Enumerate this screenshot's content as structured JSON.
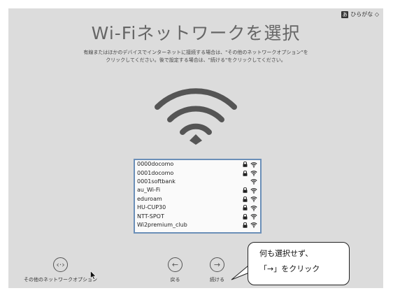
{
  "ime": {
    "badge": "あ",
    "label": "ひらがな ◇"
  },
  "title": "Wi-Fiネットワークを選択",
  "description": {
    "line1": "有線またはほかのデバイスでインターネットに接続する場合は、\"その他のネットワークオプション\"を",
    "line2": "クリックしてください。後で設定する場合は、\"続ける\"をクリックしてください。"
  },
  "networks": [
    {
      "name": "0000docomo",
      "locked": true
    },
    {
      "name": "0001docomo",
      "locked": true
    },
    {
      "name": "0001softbank",
      "locked": false
    },
    {
      "name": "au_Wi-Fi",
      "locked": true
    },
    {
      "name": "eduroam",
      "locked": true
    },
    {
      "name": "HU-CUP30",
      "locked": true
    },
    {
      "name": "NTT-SPOT",
      "locked": true
    },
    {
      "name": "Wi2premium_club",
      "locked": true
    }
  ],
  "buttons": {
    "other_options": {
      "icon": "‹·›",
      "label": "その他のネットワークオプション"
    },
    "back": {
      "icon": "←",
      "label": "戻る"
    },
    "continue": {
      "icon": "→",
      "label": "続ける"
    }
  },
  "callout": {
    "line1": "何も選択せず、",
    "line2": "「→」をクリック"
  },
  "colors": {
    "background": "#dcdcdc",
    "list_border": "#6b8fb8"
  }
}
